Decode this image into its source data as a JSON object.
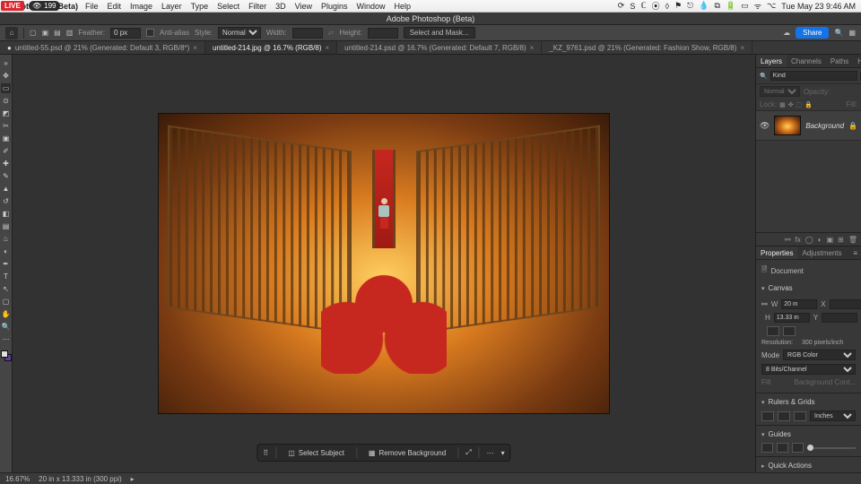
{
  "os": {
    "live_badge": "LIVE",
    "viewers": "199",
    "app_name": "Photoshop (Beta)",
    "menus": [
      "File",
      "Edit",
      "Image",
      "Layer",
      "Type",
      "Select",
      "Filter",
      "3D",
      "View",
      "Plugins",
      "Window",
      "Help"
    ],
    "right_icons": [
      "sync-icon",
      "s-icon",
      "c-icon",
      "record-icon",
      "adobe-icon",
      "flag-icon",
      "vpn-icon",
      "drop-icon",
      "hash-icon",
      "battery-icon",
      "card-icon",
      "wifi-icon",
      "control-center-icon"
    ],
    "clock": "Tue May 23  9:46 AM"
  },
  "titlebar": {
    "title": "Adobe Photoshop (Beta)"
  },
  "options_bar": {
    "feather_label": "Feather:",
    "feather_value": "0 px",
    "antialias_label": "Anti-alias",
    "style_label": "Style:",
    "style_value": "Normal",
    "width_label": "Width:",
    "height_label": "Height:",
    "select_mask": "Select and Mask...",
    "share": "Share"
  },
  "doc_tabs": [
    {
      "label": "untitled-55.psd @ 21% (Generated: Default 3, RGB/8*)",
      "dirty": true,
      "active": false
    },
    {
      "label": "untitled-214.jpg @ 16.7% (RGB/8)",
      "dirty": false,
      "active": true
    },
    {
      "label": "untitled-214.psd @ 16.7% (Generated: Default 7, RGB/8)",
      "dirty": false,
      "active": false
    },
    {
      "label": "_KZ_9761.psd @ 21% (Generated: Fashion Show, RGB/8)",
      "dirty": false,
      "active": false
    }
  ],
  "tools": [
    {
      "name": "move-tool",
      "glyph": "✥"
    },
    {
      "name": "marquee-tool",
      "glyph": "▭",
      "active": true
    },
    {
      "name": "lasso-tool",
      "glyph": "⊙"
    },
    {
      "name": "object-select-tool",
      "glyph": "◩"
    },
    {
      "name": "crop-tool",
      "glyph": "✂"
    },
    {
      "name": "frame-tool",
      "glyph": "▣"
    },
    {
      "name": "eyedropper-tool",
      "glyph": "✐"
    },
    {
      "name": "healing-tool",
      "glyph": "✚"
    },
    {
      "name": "brush-tool",
      "glyph": "✎"
    },
    {
      "name": "stamp-tool",
      "glyph": "▲"
    },
    {
      "name": "history-brush-tool",
      "glyph": "↺"
    },
    {
      "name": "eraser-tool",
      "glyph": "◧"
    },
    {
      "name": "gradient-tool",
      "glyph": "▤"
    },
    {
      "name": "blur-tool",
      "glyph": "♨"
    },
    {
      "name": "dodge-tool",
      "glyph": "◐"
    },
    {
      "name": "pen-tool",
      "glyph": "✒"
    },
    {
      "name": "type-tool",
      "glyph": "T"
    },
    {
      "name": "path-select-tool",
      "glyph": "↖"
    },
    {
      "name": "shape-tool",
      "glyph": "▢"
    },
    {
      "name": "hand-tool",
      "glyph": "✋"
    },
    {
      "name": "zoom-tool",
      "glyph": "🔍"
    },
    {
      "name": "more-tools",
      "glyph": "⋯"
    }
  ],
  "context_bar": {
    "select_subject": "Select Subject",
    "remove_bg": "Remove Background"
  },
  "layers_panel": {
    "tabs": [
      "Layers",
      "Channels",
      "Paths",
      "History"
    ],
    "active_tab": "Layers",
    "search_placeholder": "Kind",
    "blend_mode": "Normal",
    "opacity_label": "Opacity:",
    "lock_label": "Lock:",
    "fill_label": "Fill:",
    "layer_name": "Background"
  },
  "properties_panel": {
    "tabs": [
      "Properties",
      "Adjustments"
    ],
    "active_tab": "Properties",
    "doc_label": "Document",
    "canvas_label": "Canvas",
    "w_label": "W",
    "h_label": "H",
    "x_label": "X",
    "y_label": "Y",
    "width_value": "20 in",
    "height_value": "13.33 in",
    "resolution_label": "Resolution:",
    "resolution_value": "300 pixels/inch",
    "mode_label": "Mode",
    "mode_value": "RGB Color",
    "bits_value": "8 Bits/Channel",
    "fill_label": "Fill",
    "bg_contents": "Background Cont...",
    "rulers_label": "Rulers & Grids",
    "rulers_unit": "Inches",
    "guides_label": "Guides",
    "quick_actions_label": "Quick Actions"
  },
  "status_bar": {
    "zoom": "16.67%",
    "doc_info": "20 in x 13.333 in (300 ppi)"
  }
}
